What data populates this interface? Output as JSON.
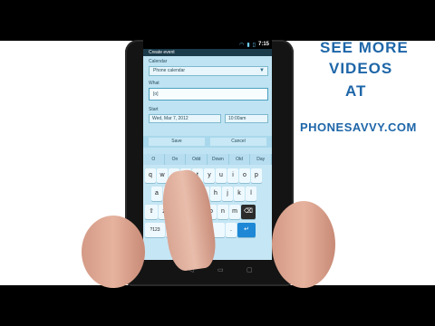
{
  "promo": {
    "line1": "SEE MORE",
    "line2": "VIDEOS",
    "line3": "AT",
    "line4": "PHONESAVVY.COM"
  },
  "status_bar": {
    "time": "7:15"
  },
  "app": {
    "title": "Create event"
  },
  "form": {
    "calendar_label": "Calendar",
    "calendar_value": "Phone calendar",
    "what_label": "What",
    "what_value": "[o]",
    "start_label": "Start",
    "start_date": "Wed, Mar 7, 2012",
    "start_time": "10:00am"
  },
  "actions": {
    "save": "Save",
    "cancel": "Cancel"
  },
  "suggestions": [
    "O",
    "On",
    "Odd",
    "Down",
    "Old",
    "Day"
  ],
  "keyboard": {
    "row1": [
      "q",
      "w",
      "e",
      "r",
      "t",
      "y",
      "u",
      "i",
      "o",
      "p"
    ],
    "row2": [
      "a",
      "s",
      "d",
      "f",
      "g",
      "h",
      "j",
      "k",
      "l"
    ],
    "row3": [
      "z",
      "x",
      "c",
      "v",
      "b",
      "n",
      "m"
    ],
    "space_label": "___",
    "enter_label": "↵",
    "delete_label": "⌫",
    "num_label": "?123",
    "comma_label": ",",
    "period_label": "."
  },
  "accent_color": "#1e88d6",
  "promo_color": "#1e66a8"
}
